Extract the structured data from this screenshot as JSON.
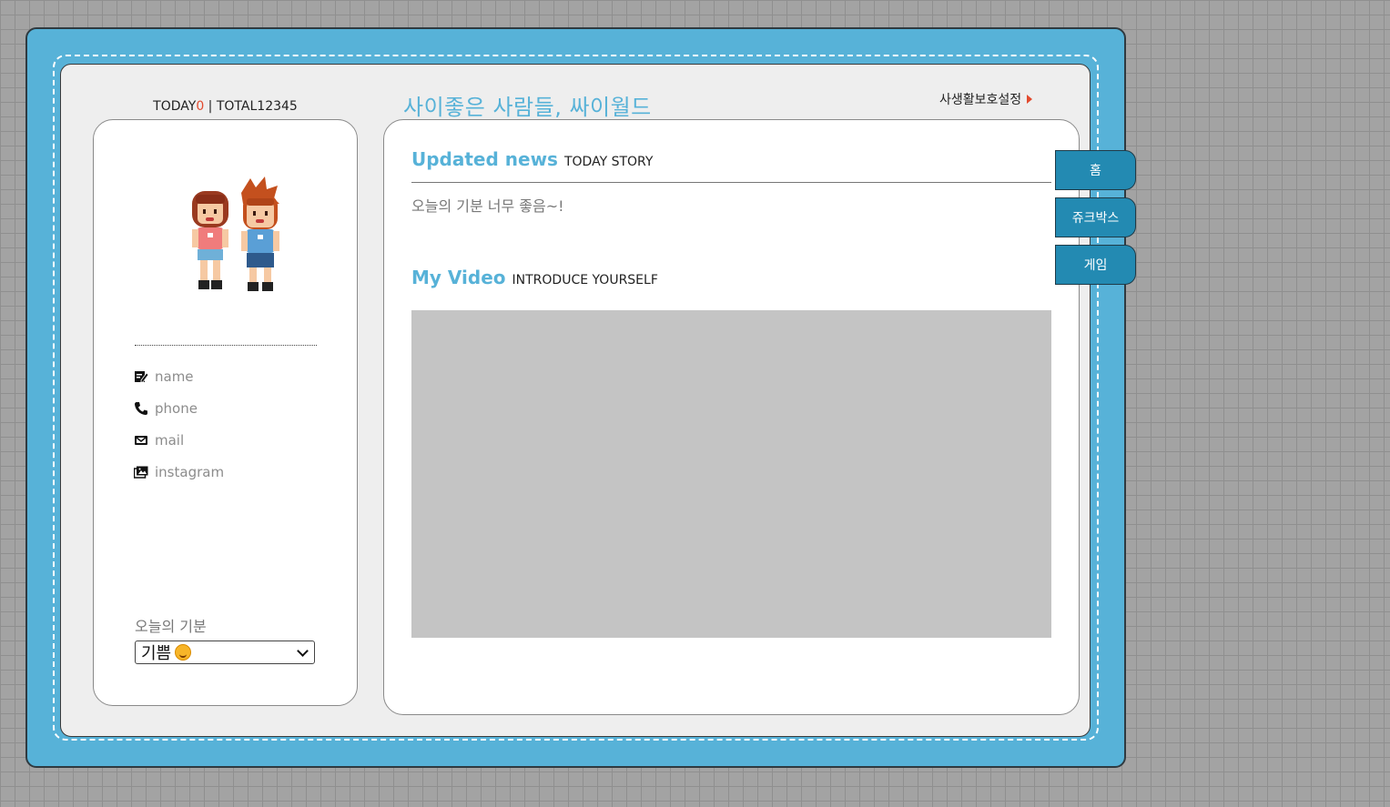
{
  "header": {
    "today_label": "TODAY",
    "today_count": "0",
    "separator": " | ",
    "total_label": "TOTAL",
    "total_count": "12345",
    "site_title": "사이좋은 사람들, 싸이월드",
    "privacy_link": "사생활보호설정"
  },
  "profile": {
    "avatar": "couple-pixel-avatar",
    "info": [
      {
        "icon": "edit-icon",
        "label": "name"
      },
      {
        "icon": "phone-icon",
        "label": "phone"
      },
      {
        "icon": "mail-icon",
        "label": "mail"
      },
      {
        "icon": "image-icon",
        "label": "instagram"
      }
    ],
    "mood_label": "오늘의 기분",
    "mood_value": "기쁨"
  },
  "main": {
    "news_title": "Updated news",
    "news_subtitle": "TODAY STORY",
    "news_text": "오늘의 기분 너무 좋음~!",
    "video_title": "My Video",
    "video_subtitle": "INTRODUCE YOURSELF"
  },
  "tabs": [
    {
      "label": "홈"
    },
    {
      "label": "쥬크박스"
    },
    {
      "label": "게임"
    }
  ],
  "colors": {
    "frame": "#57b2d8",
    "accent": "#57b2d8",
    "tab": "#238ab2",
    "today_count": "#e24a2e",
    "video_placeholder": "#c4c4c4"
  }
}
